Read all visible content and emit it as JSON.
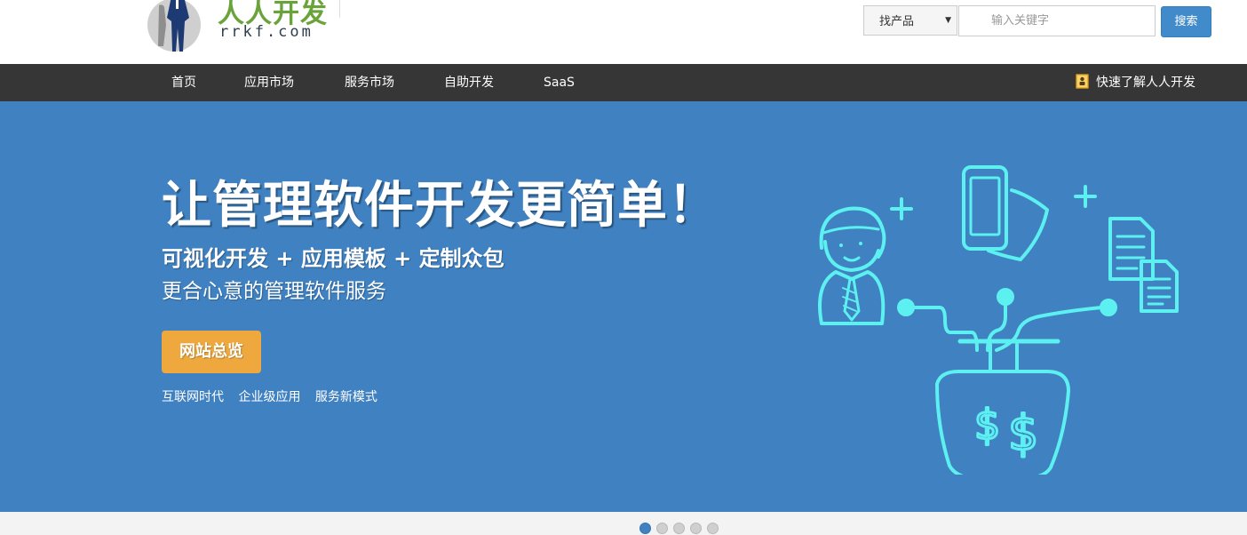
{
  "header": {
    "logo_cn": "人人开发",
    "logo_en": "rrkf.com",
    "search": {
      "category": "找产品",
      "placeholder": "输入关键字",
      "button_label": "搜索"
    }
  },
  "nav": {
    "items": [
      {
        "label": "首页"
      },
      {
        "label": "应用市场"
      },
      {
        "label": "服务市场"
      },
      {
        "label": "自助开发"
      },
      {
        "label": "SaaS"
      }
    ],
    "right_link": "快速了解人人开发"
  },
  "hero": {
    "title": "让管理软件开发更简单！",
    "subtitle": "可视化开发 + 应用模板 + 定制众包",
    "subtitle2": "更合心意的管理软件服务",
    "cta_label": "网站总览",
    "tags": [
      "互联网时代",
      "企业级应用",
      "服务新模式"
    ]
  },
  "carousel": {
    "slide_count": 5,
    "active_index": 0
  },
  "colors": {
    "banner_bg": "#3f81c1",
    "nav_bg": "#363636",
    "cta_bg": "#eea83d",
    "search_button": "#428bca",
    "illustration_stroke": "#5cf0f0",
    "logo_green": "#6aa33a"
  },
  "icons": {
    "logo": "person-silhouette-logo",
    "right_link": "book-icon",
    "illustration": "developer-device-money-illustration"
  }
}
